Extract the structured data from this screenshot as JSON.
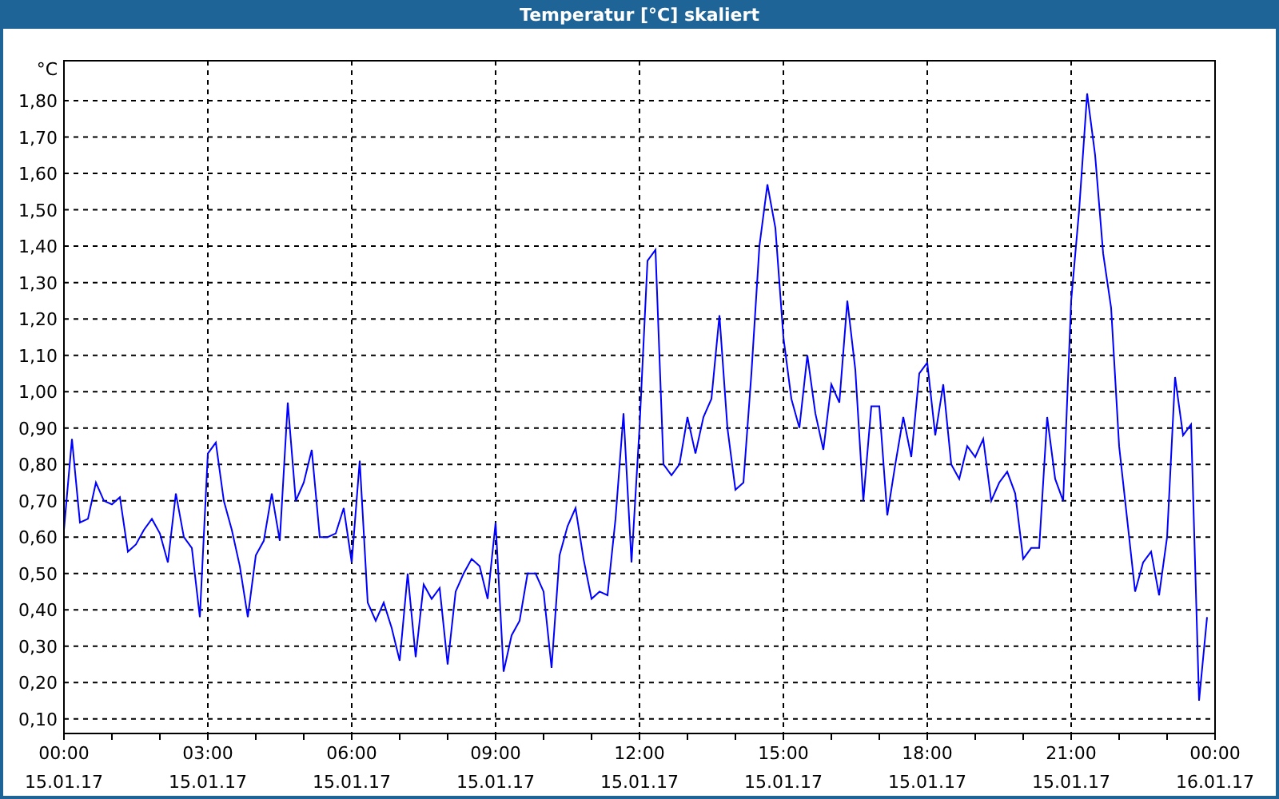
{
  "window": {
    "title": "Temperatur [°C] skaliert"
  },
  "chart": {
    "chart_data": {
      "type": "line",
      "grid": true,
      "ylabel": "°C",
      "ylim": [
        0.06,
        1.91
      ],
      "yticks": [
        {
          "value": 0.1,
          "label": "0,10"
        },
        {
          "value": 0.2,
          "label": "0,20"
        },
        {
          "value": 0.3,
          "label": "0,30"
        },
        {
          "value": 0.4,
          "label": "0,40"
        },
        {
          "value": 0.5,
          "label": "0,50"
        },
        {
          "value": 0.6,
          "label": "0,60"
        },
        {
          "value": 0.7,
          "label": "0,70"
        },
        {
          "value": 0.8,
          "label": "0,80"
        },
        {
          "value": 0.9,
          "label": "0,90"
        },
        {
          "value": 1.0,
          "label": "1,00"
        },
        {
          "value": 1.1,
          "label": "1,10"
        },
        {
          "value": 1.2,
          "label": "1,20"
        },
        {
          "value": 1.3,
          "label": "1,30"
        },
        {
          "value": 1.4,
          "label": "1,40"
        },
        {
          "value": 1.5,
          "label": "1,50"
        },
        {
          "value": 1.6,
          "label": "1,60"
        },
        {
          "value": 1.7,
          "label": "1,70"
        },
        {
          "value": 1.8,
          "label": "1,80"
        }
      ],
      "categories": [
        "00:00 15.01.17",
        null,
        null,
        null,
        null,
        null,
        null,
        null,
        null,
        null,
        null,
        null,
        null,
        null,
        null,
        null,
        null,
        null,
        "03:00 15.01.17",
        null,
        null,
        null,
        null,
        null,
        null,
        null,
        null,
        null,
        null,
        null,
        null,
        null,
        null,
        null,
        null,
        null,
        "06:00 15.01.17",
        null,
        null,
        null,
        null,
        null,
        null,
        null,
        null,
        null,
        null,
        null,
        null,
        null,
        null,
        null,
        null,
        null,
        "09:00 15.01.17",
        null,
        null,
        null,
        null,
        null,
        null,
        null,
        null,
        null,
        null,
        null,
        null,
        null,
        null,
        null,
        null,
        null,
        "12:00 15.01.17",
        null,
        null,
        null,
        null,
        null,
        null,
        null,
        null,
        null,
        null,
        null,
        null,
        null,
        null,
        null,
        null,
        null,
        "15:00 15.01.17",
        null,
        null,
        null,
        null,
        null,
        null,
        null,
        null,
        null,
        null,
        null,
        null,
        null,
        null,
        null,
        null,
        null,
        "18:00 15.01.17",
        null,
        null,
        null,
        null,
        null,
        null,
        null,
        null,
        null,
        null,
        null,
        null,
        null,
        null,
        null,
        null,
        null,
        "21:00 15.01.17",
        null,
        null,
        null,
        null,
        null,
        null,
        null,
        null,
        null,
        null,
        null,
        null,
        null,
        null,
        null,
        null,
        null,
        "00:00 16.01.17"
      ],
      "series": [
        {
          "color": "#0000ff",
          "values": [
            0.62,
            0.87,
            0.64,
            0.65,
            0.75,
            0.7,
            0.69,
            0.71,
            0.56,
            0.58,
            0.62,
            0.65,
            0.61,
            0.53,
            0.72,
            0.6,
            0.57,
            0.38,
            0.83,
            0.86,
            0.7,
            0.62,
            0.52,
            0.38,
            0.55,
            0.59,
            0.72,
            0.59,
            0.97,
            0.7,
            0.75,
            0.84,
            0.6,
            0.6,
            0.61,
            0.68,
            0.53,
            0.81,
            0.42,
            0.37,
            0.42,
            0.35,
            0.26,
            0.5,
            0.27,
            0.47,
            0.43,
            0.46,
            0.25,
            0.45,
            0.5,
            0.54,
            0.52,
            0.43,
            0.64,
            0.23,
            0.33,
            0.37,
            0.5,
            0.5,
            0.45,
            0.24,
            0.55,
            0.63,
            0.68,
            0.54,
            0.43,
            0.45,
            0.44,
            0.65,
            0.94,
            0.53,
            0.9,
            1.36,
            1.39,
            0.8,
            0.77,
            0.8,
            0.93,
            0.83,
            0.93,
            0.98,
            1.21,
            0.9,
            0.73,
            0.75,
            1.05,
            1.4,
            1.57,
            1.45,
            1.15,
            0.98,
            0.9,
            1.1,
            0.94,
            0.84,
            1.02,
            0.97,
            1.25,
            1.06,
            0.7,
            0.96,
            0.96,
            0.66,
            0.8,
            0.93,
            0.82,
            1.05,
            1.08,
            0.88,
            1.02,
            0.8,
            0.76,
            0.85,
            0.82,
            0.87,
            0.7,
            0.75,
            0.78,
            0.72,
            0.54,
            0.57,
            0.57,
            0.93,
            0.76,
            0.7,
            1.25,
            1.5,
            1.82,
            1.65,
            1.38,
            1.23,
            0.85,
            0.65,
            0.45,
            0.53,
            0.56,
            0.44,
            0.6,
            1.04,
            0.88,
            0.91,
            0.15,
            0.38,
            null
          ]
        }
      ]
    }
  }
}
